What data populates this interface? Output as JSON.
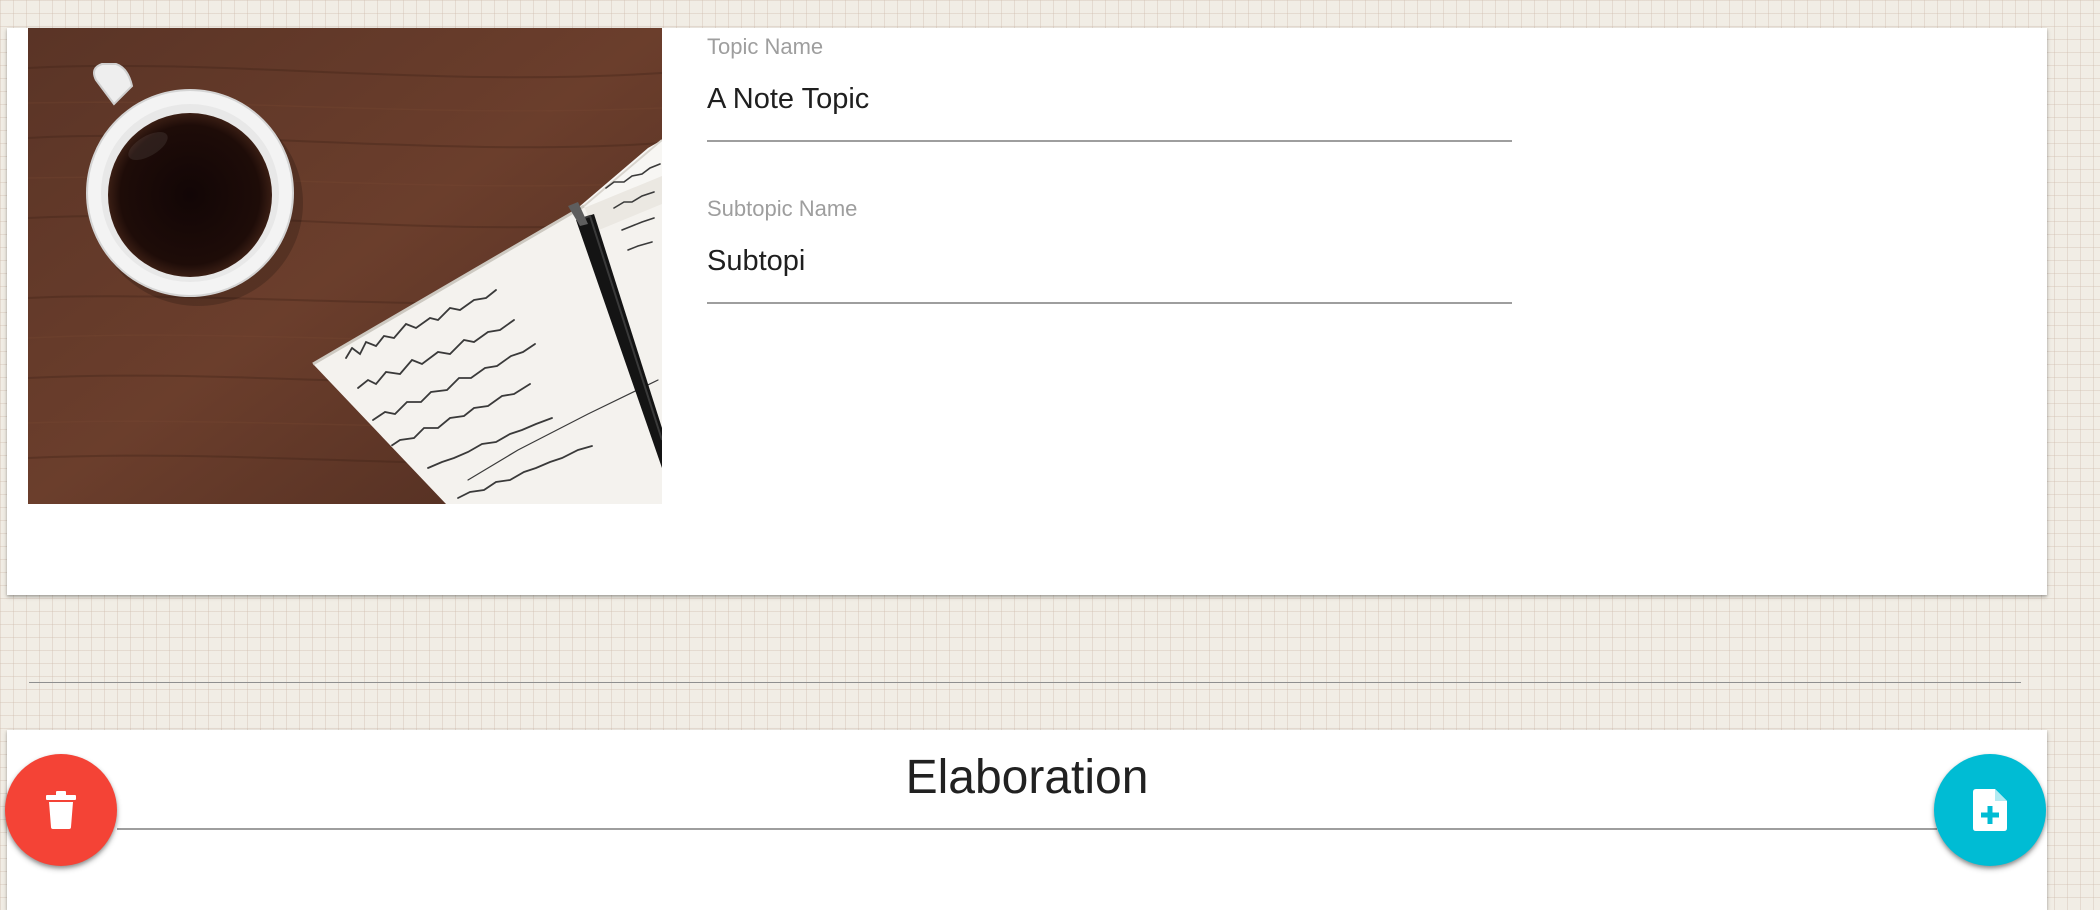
{
  "topic": {
    "label": "Topic Name",
    "value": "A Note Topic"
  },
  "subtopic": {
    "label": "Subtopic Name",
    "value": "Subtopi"
  },
  "section": {
    "title": "Elaboration"
  },
  "buttons": {
    "delete": {
      "icon": "trash-icon",
      "color": "#f44336"
    },
    "add": {
      "icon": "note-add-icon",
      "color": "#00bcd4"
    }
  },
  "photo": {
    "notebook_lines": [
      "J(θ) = 1/m Σ Cost(hθ(x(i)), y(i))",
      "Cost(hθ(x),y) = { -log(hθ(x)) if y=1 ; -log(1-hθ(x)) if y=0 }",
      "Cost(hθ(x),y) = -y log(hθ(x)) - (1-y)log(1-hθ(x))",
      "If y=1 : -1 log(hθ) - 0",
      "y=0 : 0 - log(1-hθ(x))",
      "J(θ) =",
      "-1/m [Σ y(i) log(hθ(x(i))) + (1-y(i)) log(1-hθ(x(i)))]"
    ],
    "notebook_right_lines": [
      "Gradient Descent",
      "repeat { θj := θj - α ...",
      "}"
    ]
  }
}
